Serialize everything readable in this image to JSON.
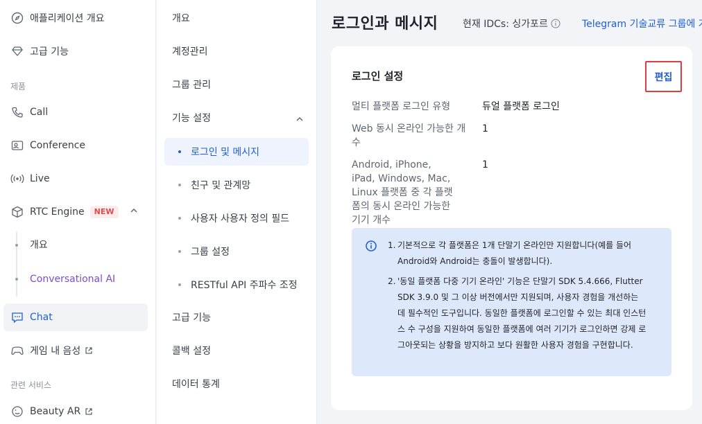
{
  "nav1": {
    "items": [
      {
        "label": "애플리케이션 개요",
        "icon": "compass-icon"
      },
      {
        "label": "고급 기능",
        "icon": "diamond-icon"
      },
      {
        "label": "Call",
        "icon": "phone-icon"
      },
      {
        "label": "Conference",
        "icon": "conference-icon"
      },
      {
        "label": "Live",
        "icon": "broadcast-icon"
      },
      {
        "label": "RTC Engine",
        "icon": "cube-icon",
        "badge": "NEW"
      },
      {
        "label": "Chat",
        "icon": "chat-icon"
      },
      {
        "label": "게임 내 음성",
        "icon": "gamepad-icon"
      },
      {
        "label": "Beauty AR",
        "icon": "beauty-icon"
      }
    ],
    "section_products": "제품",
    "section_related": "관련 서비스",
    "rtc_sub": [
      {
        "label": "개요"
      },
      {
        "label": "Conversational AI"
      }
    ]
  },
  "nav2": {
    "items": [
      "개요",
      "계정관리",
      "그룹 관리",
      "기능 설정",
      "고급 기능",
      "콜백 설정",
      "데이터 통계"
    ],
    "sub": [
      "로그인 및 메시지",
      "친구 및 관계망",
      "사용자 사용자 정의 필드",
      "그룹 설정",
      "RESTful API 주파수 조정"
    ]
  },
  "header": {
    "title": "로그인과 메시지",
    "idc": "현재 IDCs: 싱가포르",
    "telegram": "Telegram 기술교류 그룹에 가"
  },
  "card": {
    "title": "로그인 설정",
    "edit": "편집",
    "rows": [
      {
        "label": "멀티 플랫폼 로그인 유형",
        "value": "듀얼 플랫폼 로그인"
      },
      {
        "label": "Web 동시 온라인 가능한 개수",
        "value": "1"
      },
      {
        "label": "Android, iPhone, iPad, Windows, Mac, Linux 플랫폼 중 각 플랫폼의 동시 온라인 가능한 기기 개수",
        "value": "1"
      }
    ],
    "notice": [
      "기본적으로 각 플랫폼은 1개 단말기 온라인만 지원합니다(예를 들어 Android와 Android는 충돌이 발생합니다).",
      "'동일 플랫폼 다중 기기 온라인' 기능은 단말기 SDK 5.4.666, Flutter SDK 3.9.0 및 그 이상 버전에서만 지원되며, 사용자 경험을 개선하는 데 필수적인 도구입니다. 동일한 플랫폼에 로그인할 수 있는 최대 인스턴스 수 구성을 지원하여 동일한 플랫폼에 여러 기기가 로그인하면 강제 로그아웃되는 상황을 방지하고 보다 원활한 사용자 경험을 구현합니다."
    ]
  },
  "colors": {
    "accent": "#1f5fd6",
    "badge": "#e5484d",
    "highlight": "#e23b3b",
    "purple": "#7b4ccf"
  }
}
